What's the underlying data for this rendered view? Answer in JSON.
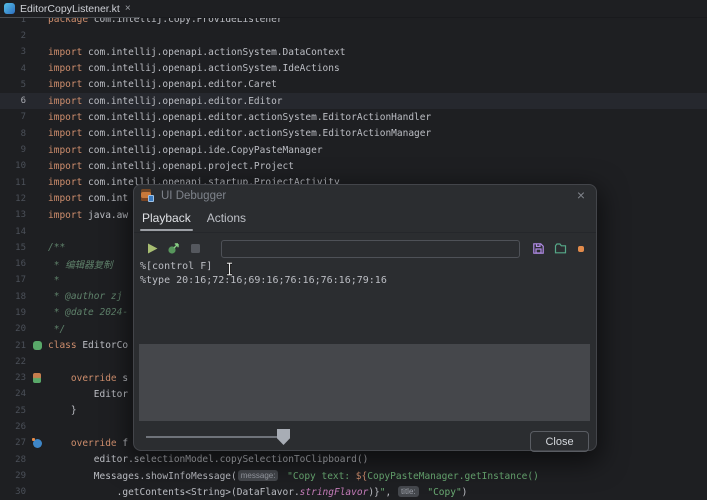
{
  "colors": {
    "editor_bg": "#1e1f22",
    "current_line": "#26282e",
    "keyword": "#cf8e6d",
    "plain": "#bcbec4",
    "string": "#6aab73",
    "doc_comment": "#5f826b",
    "dialog_bg": "#2b2d30",
    "panel": "#45474b",
    "accent_orange": "#e28b4b"
  },
  "tab_bar": {
    "file_tab": {
      "icon": "kotlin-file-icon",
      "label": "EditorCopyListener.kt",
      "close": "×"
    }
  },
  "editor": {
    "lines": [
      {
        "n": 1,
        "seg": [
          {
            "c": "kw",
            "t": "package"
          },
          {
            "c": "tx",
            "t": " com.intellij.copy.ProvideListener"
          }
        ]
      },
      {
        "n": 2,
        "seg": []
      },
      {
        "n": 3,
        "seg": [
          {
            "c": "kw",
            "t": "import"
          },
          {
            "c": "tx",
            "t": " com.intellij.openapi.actionSystem.DataContext"
          }
        ]
      },
      {
        "n": 4,
        "seg": [
          {
            "c": "kw",
            "t": "import"
          },
          {
            "c": "tx",
            "t": " com.intellij.openapi.actionSystem.IdeActions"
          }
        ]
      },
      {
        "n": 5,
        "seg": [
          {
            "c": "kw",
            "t": "import"
          },
          {
            "c": "tx",
            "t": " com.intellij.openapi.editor.Caret"
          }
        ]
      },
      {
        "n": 6,
        "current": true,
        "seg": [
          {
            "c": "kw",
            "t": "import"
          },
          {
            "c": "tx",
            "t": " com.intellij.openapi.editor.Editor"
          }
        ]
      },
      {
        "n": 7,
        "seg": [
          {
            "c": "kw",
            "t": "import"
          },
          {
            "c": "tx",
            "t": " com.intellij.openapi.editor.actionSystem.EditorActionHandler"
          }
        ]
      },
      {
        "n": 8,
        "seg": [
          {
            "c": "kw",
            "t": "import"
          },
          {
            "c": "tx",
            "t": " com.intellij.openapi.editor.actionSystem.EditorActionManager"
          }
        ]
      },
      {
        "n": 9,
        "seg": [
          {
            "c": "kw",
            "t": "import"
          },
          {
            "c": "tx",
            "t": " com.intellij.openapi.ide.CopyPasteManager"
          }
        ]
      },
      {
        "n": 10,
        "seg": [
          {
            "c": "kw",
            "t": "import"
          },
          {
            "c": "tx",
            "t": " com.intellij.openapi.project.Project"
          }
        ]
      },
      {
        "n": 11,
        "seg": [
          {
            "c": "kw",
            "t": "import"
          },
          {
            "c": "tx",
            "t": " com.intellij.openapi.startup.ProjectActivity"
          }
        ]
      },
      {
        "n": 12,
        "seg": [
          {
            "c": "kw",
            "t": "import"
          },
          {
            "c": "tx",
            "t": " com.int"
          }
        ]
      },
      {
        "n": 13,
        "seg": [
          {
            "c": "kw",
            "t": "import"
          },
          {
            "c": "tx",
            "t": " java.aw"
          }
        ]
      },
      {
        "n": 14,
        "seg": []
      },
      {
        "n": 15,
        "seg": [
          {
            "c": "dc",
            "t": "/**"
          }
        ]
      },
      {
        "n": 16,
        "seg": [
          {
            "c": "dc",
            "t": " * 编辑器复制"
          }
        ]
      },
      {
        "n": 17,
        "seg": [
          {
            "c": "dc",
            "t": " *"
          }
        ]
      },
      {
        "n": 18,
        "seg": [
          {
            "c": "dc",
            "t": " * @author zj"
          }
        ]
      },
      {
        "n": 19,
        "seg": [
          {
            "c": "dc",
            "t": " * @date 2024-"
          }
        ]
      },
      {
        "n": 20,
        "seg": [
          {
            "c": "dc",
            "t": " */"
          }
        ]
      },
      {
        "n": 21,
        "icon": "class-icon",
        "seg": [
          {
            "c": "kw",
            "t": "class"
          },
          {
            "c": "tx",
            "t": " EditorCo"
          }
        ]
      },
      {
        "n": 22,
        "seg": []
      },
      {
        "n": 23,
        "icon": "override-method-icon",
        "seg": [
          {
            "c": "tx",
            "t": "    "
          },
          {
            "c": "kw",
            "t": "override"
          },
          {
            "c": "tx",
            "t": " s"
          }
        ]
      },
      {
        "n": 24,
        "seg": [
          {
            "c": "tx",
            "t": "        Editor"
          }
        ]
      },
      {
        "n": 25,
        "seg": [
          {
            "c": "tx",
            "t": "    }"
          }
        ]
      },
      {
        "n": 26,
        "seg": []
      },
      {
        "n": 27,
        "icon": "implement-method-icon",
        "seg": [
          {
            "c": "tx",
            "t": "    "
          },
          {
            "c": "kw",
            "t": "override"
          },
          {
            "c": "tx",
            "t": " f"
          }
        ]
      },
      {
        "n": 28,
        "seg": [
          {
            "c": "tx",
            "t": "        editor.selectionModel.copySelectionToClipboard()"
          }
        ]
      },
      {
        "n": 29,
        "seg": [
          {
            "c": "tx",
            "t": "        Messages.showInfoMessage("
          },
          {
            "c": "hint",
            "t": "message:"
          },
          {
            "c": "st",
            "t": " \"Copy text: "
          },
          {
            "c": "tp",
            "t": "${"
          },
          {
            "c": "st",
            "t": "CopyPasteManager.getInstance()"
          }
        ]
      },
      {
        "n": 30,
        "seg": [
          {
            "c": "tx",
            "t": "            .getContents<String>(DataFlavor."
          },
          {
            "c": "it",
            "t": "stringFlavor"
          },
          {
            "c": "tx",
            "t": ")}"
          },
          {
            "c": "st",
            "t": "\""
          },
          {
            "c": "tx",
            "t": ", "
          },
          {
            "c": "hint",
            "t": "title:"
          },
          {
            "c": "st",
            "t": " \"Copy\""
          },
          {
            "c": "tx",
            "t": ")"
          }
        ]
      }
    ]
  },
  "dialog": {
    "title": "UI Debugger",
    "close": "×",
    "tabs": [
      {
        "label": "Playback",
        "selected": true
      },
      {
        "label": "Actions",
        "selected": false
      }
    ],
    "toolbar": {
      "left_icons": [
        "play-icon",
        "run-target-icon",
        "stop-icon"
      ],
      "input": {
        "value": "",
        "placeholder": ""
      },
      "right_icons": [
        "save-icon",
        "folder-icon",
        "record-dot-icon"
      ]
    },
    "script_lines": [
      "%[control F]",
      "%type 20:16;72:16;69:16;76:16;76:16;79:16"
    ],
    "close_button": "Close"
  }
}
